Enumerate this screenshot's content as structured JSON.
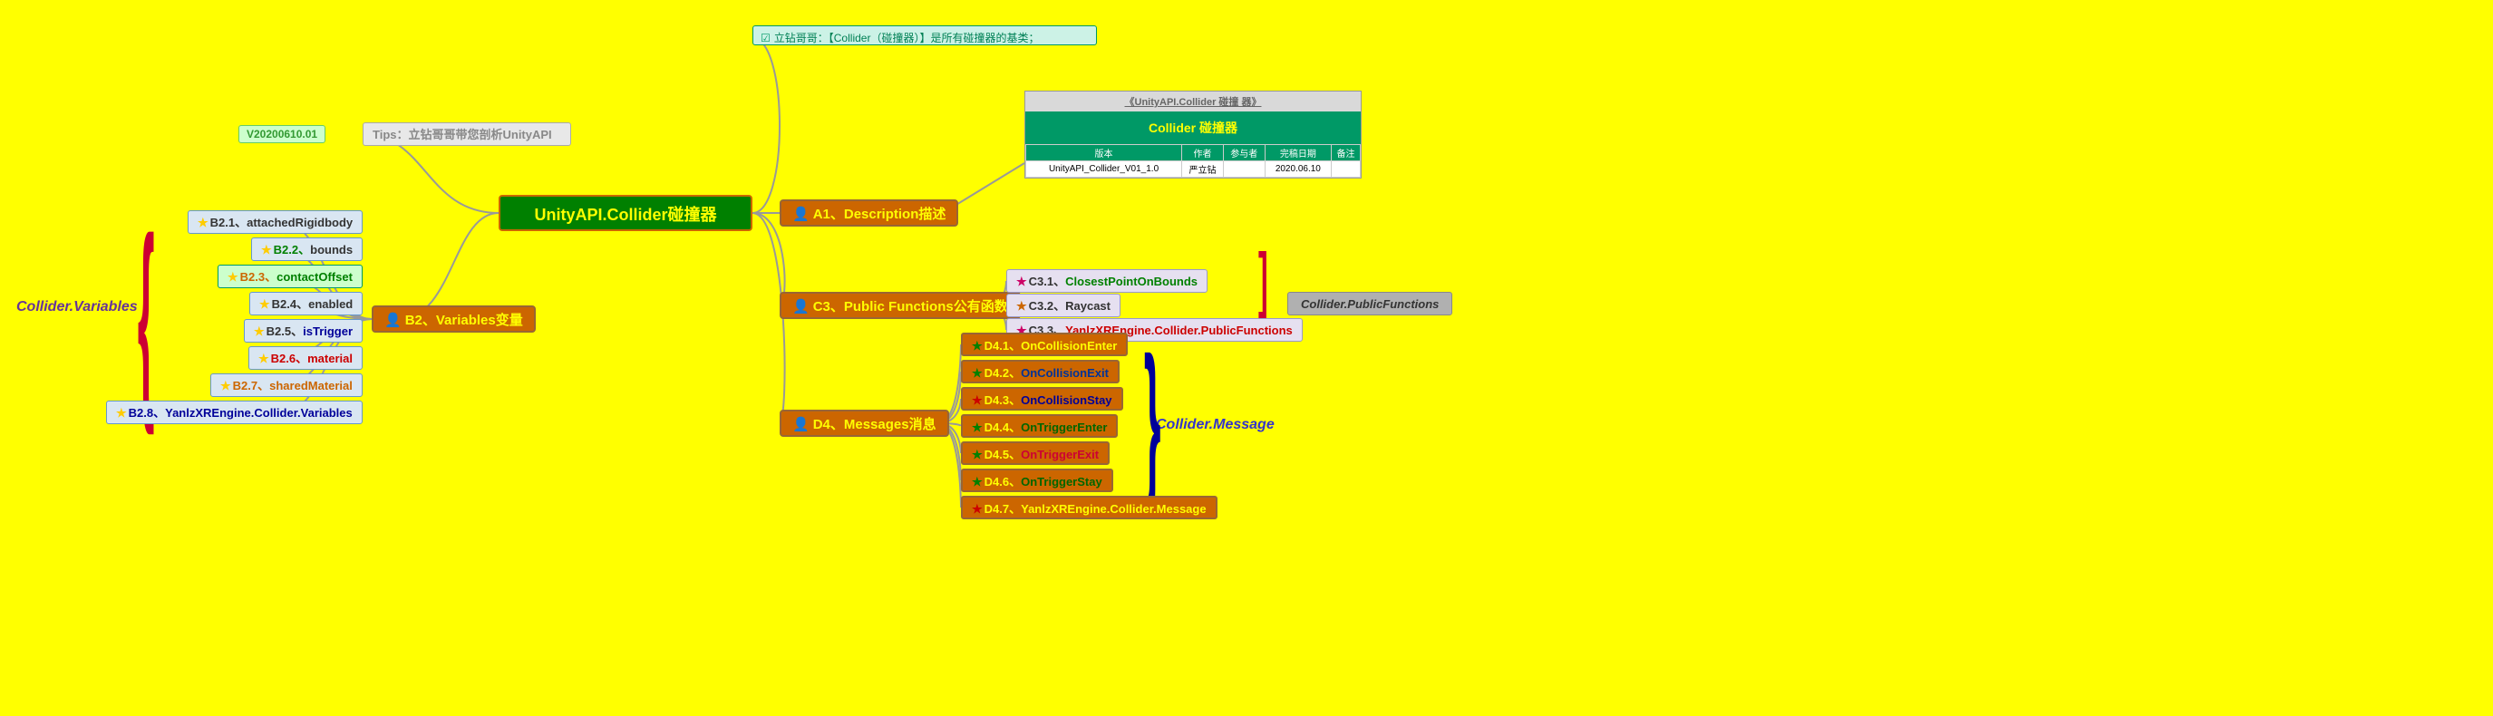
{
  "root": "UnityAPI.Collider碰撞器",
  "version": "V20200610.01",
  "tips": "Tips：立钻哥哥带您剖析UnityAPI",
  "topNote": "立钻哥哥：【Collider（碰撞器）】是所有碰撞器的基类；",
  "branches": {
    "a1": "A1、Description描述",
    "b2": "B2、Variables变量",
    "c3": "C3、Public Functions公有函数",
    "d4": "D4、Messages消息"
  },
  "b2items": [
    {
      "id": "B2.1",
      "txt": "attachedRigidbody",
      "cls": "lf-blue",
      "num": "#333",
      "col": "#333"
    },
    {
      "id": "B2.2",
      "txt": "bounds",
      "cls": "lf-blue",
      "num": "#008000",
      "col": "#333"
    },
    {
      "id": "B2.3",
      "txt": "contactOffset",
      "cls": "lf-mint",
      "num": "#cc6600",
      "col": "#008000"
    },
    {
      "id": "B2.4",
      "txt": "enabled",
      "cls": "lf-blue",
      "num": "#333",
      "col": "#333"
    },
    {
      "id": "B2.5",
      "txt": "isTrigger",
      "cls": "lf-blue",
      "num": "#333",
      "col": "#000099"
    },
    {
      "id": "B2.6",
      "txt": "material",
      "cls": "lf-blue",
      "num": "#cc0000",
      "col": "#cc0000"
    },
    {
      "id": "B2.7",
      "txt": "sharedMaterial",
      "cls": "lf-blue",
      "num": "#cc6600",
      "col": "#cc6600"
    },
    {
      "id": "B2.8",
      "txt": "YanlzXREngine.Collider.Variables",
      "cls": "lf-blue",
      "num": "#000099",
      "col": "#000099"
    }
  ],
  "c3items": [
    {
      "id": "C3.1",
      "txt": "ClosestPointOnBounds",
      "star": "#cc0066",
      "col": "#008000"
    },
    {
      "id": "C3.2",
      "txt": "Raycast",
      "star": "#cc6600",
      "col": "#333"
    },
    {
      "id": "C3.3",
      "txt": "YanlzXREngine.Collider.PublicFunctions",
      "star": "#cc0066",
      "col": "#cc0000"
    }
  ],
  "d4items": [
    {
      "id": "D4.1",
      "txt": "OnCollisionEnter",
      "star": "#008000",
      "col": "#ffff00"
    },
    {
      "id": "D4.2",
      "txt": "OnCollisionExit",
      "star": "#008000",
      "col": "#003399"
    },
    {
      "id": "D4.3",
      "txt": "OnCollisionStay",
      "star": "#cc0000",
      "col": "#000099"
    },
    {
      "id": "D4.4",
      "txt": "OnTriggerEnter",
      "star": "#008000",
      "col": "#006600"
    },
    {
      "id": "D4.5",
      "txt": "OnTriggerExit",
      "star": "#008000",
      "col": "#cc0033"
    },
    {
      "id": "D4.6",
      "txt": "OnTriggerStay",
      "star": "#008000",
      "col": "#006600"
    },
    {
      "id": "D4.7",
      "txt": "YanlzXREngine.Collider.Message",
      "star": "#cc0000",
      "col": "#ffff00"
    }
  ],
  "tags": {
    "variables": "Collider.Variables",
    "pubfunc": "Collider.PublicFunctions",
    "message": "Collider.Message"
  },
  "doc": {
    "title": "《UnityAPI.Collider 碰撞 器》",
    "sub": "Collider 碰撞器",
    "headers": [
      "版本",
      "作者",
      "参与者",
      "完稿日期",
      "备注"
    ],
    "row": [
      "UnityAPI_Collider_V01_1.0",
      "严立钻",
      "",
      "2020.06.10",
      ""
    ]
  }
}
